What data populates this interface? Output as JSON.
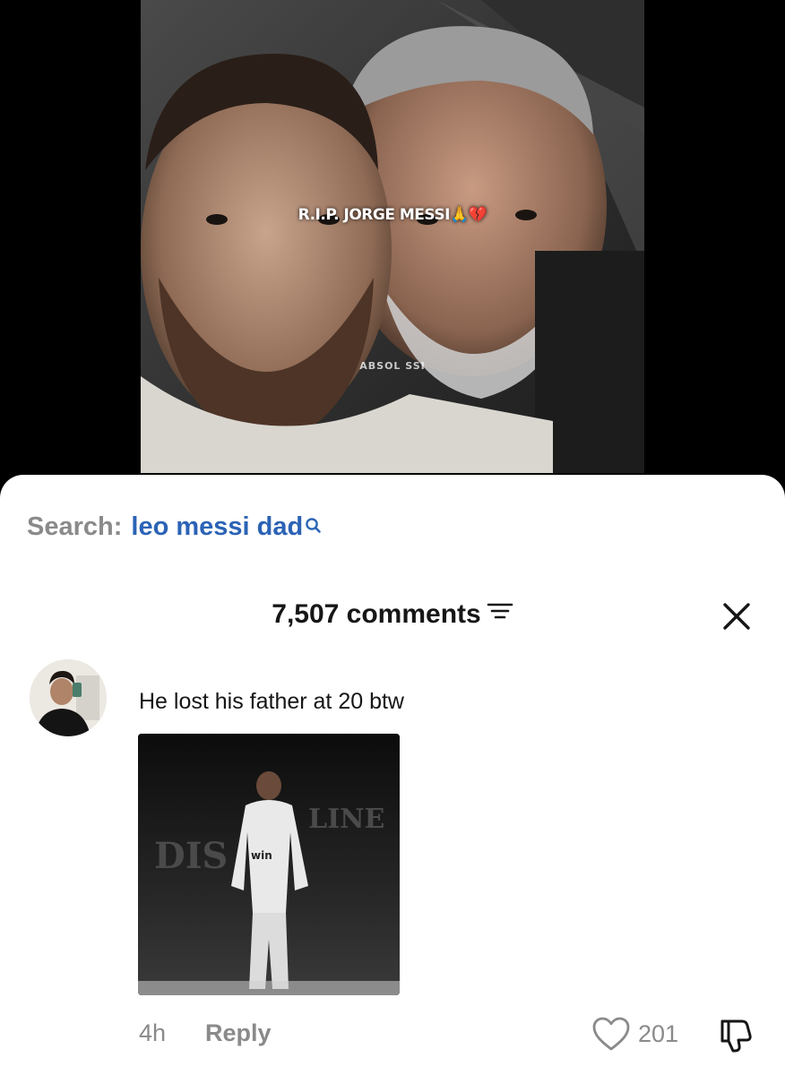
{
  "video": {
    "overlay_title": "R.I.P. JORGE MESSI🙏💔",
    "watermark": "ABSOL   SSI"
  },
  "search": {
    "label": "Search:",
    "query": "leo messi dad"
  },
  "comments": {
    "header": "7,507 comments"
  },
  "comment": {
    "text": "He lost his father at 20 btw",
    "image_overlay_left": "DIS",
    "image_overlay_right": "LINE",
    "jersey_text": "win",
    "time": "4h",
    "reply_label": "Reply",
    "like_count": "201"
  },
  "colors": {
    "accent_blue": "#2b63b5",
    "muted_gray": "#8a8a8a",
    "text_dark": "#161616",
    "sheet_bg": "#ffffff"
  },
  "icons": [
    "search-icon",
    "filter-icon",
    "close-icon",
    "heart-icon",
    "dislike-icon"
  ]
}
